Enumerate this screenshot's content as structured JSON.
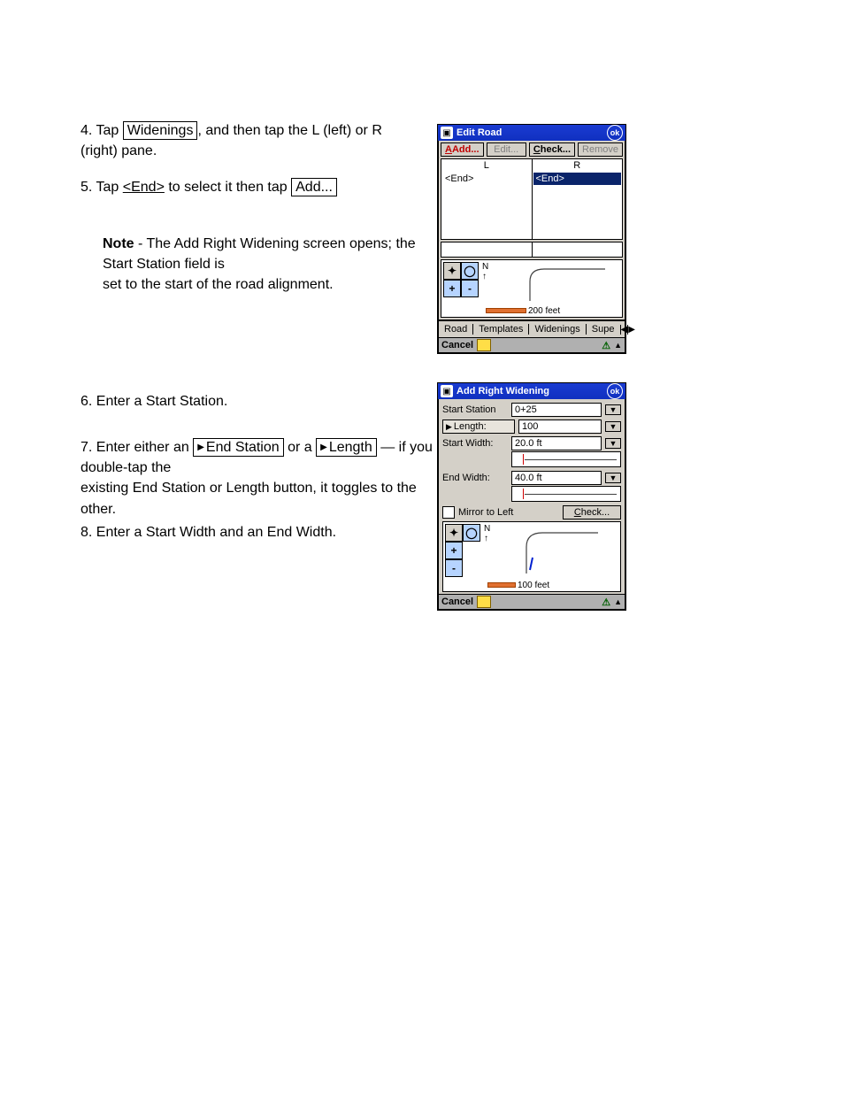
{
  "page": {
    "step_tap": "4. Tap",
    "widenings_tab": "Widenings",
    "step_after": ", and then tap the L (left) or R (right) pane."
  },
  "step5": {
    "part1": "5. Tap",
    "part2": "<End>",
    "part3": "to select it then tap"
  },
  "add_button": "Add...",
  "note_intro": "Note",
  "note_body": "- The Add Right Widening screen opens; the Start Station field is",
  "note_line2": "set to the start of the road alignment.",
  "step6": "6. Enter a Start Station.",
  "step7a": "7. Enter either an",
  "end_station_button": "End Station",
  "step7b": " or a ",
  "length_button": "Length",
  "step7c": " — if you double-tap the",
  "step7d": "existing End Station or Length button, it toggles to the other.",
  "step8": "8. Enter a Start Width and an End Width.",
  "edit_road": {
    "title": "Edit Road",
    "ok": "ok",
    "add": "Add...",
    "edit": "Edit...",
    "check": "Check...",
    "remove": "Remove",
    "L": "L",
    "R": "R",
    "end": "<End>",
    "scale": "200 feet",
    "tabs": {
      "road": "Road",
      "templates": "Templates",
      "widenings": "Widenings",
      "supe": "Supe"
    },
    "cancel": "Cancel"
  },
  "add_widening": {
    "title": "Add Right Widening",
    "ok": "ok",
    "start_station_lbl": "Start Station",
    "start_station_val": "0+25",
    "length_lbl": "Length:",
    "length_val": "100",
    "start_width_lbl": "Start Width:",
    "start_width_val": "20.0 ft",
    "end_width_lbl": "End Width:",
    "end_width_val": "40.0 ft",
    "mirror": "Mirror to Left",
    "check": "Check...",
    "scale": "100 feet",
    "cancel": "Cancel"
  }
}
